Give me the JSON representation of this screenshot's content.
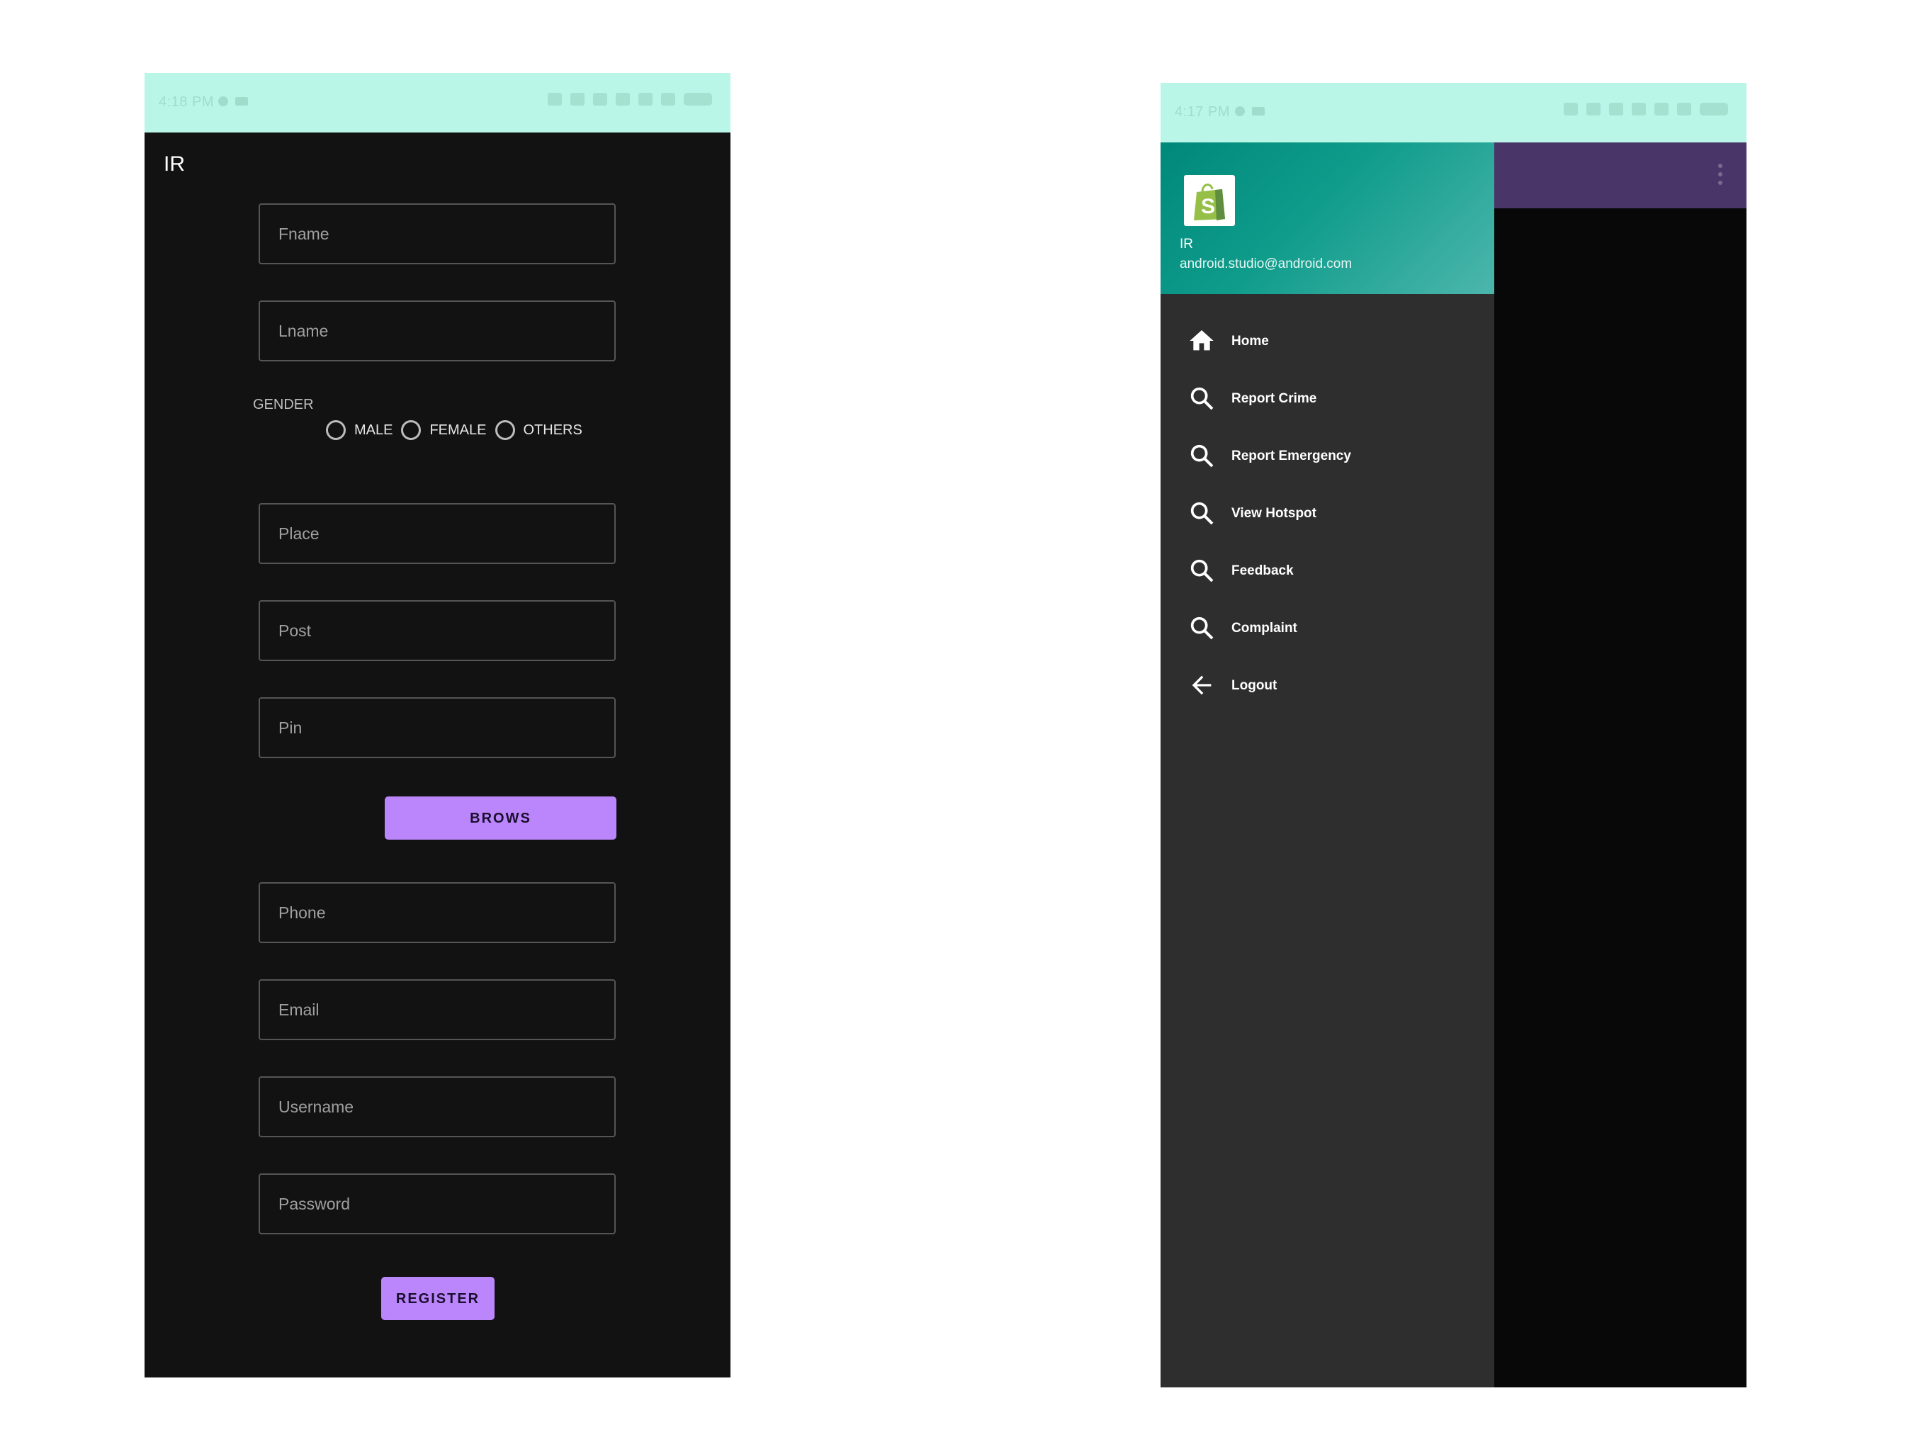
{
  "left_screen": {
    "status_time": "4:18 PM",
    "app_title": "IR",
    "fields": {
      "fname": "Fname",
      "lname": "Lname",
      "place": "Place",
      "post": "Post",
      "pin": "Pin",
      "phone": "Phone",
      "email": "Email",
      "username": "Username",
      "password": "Password"
    },
    "gender_label": "GENDER",
    "gender_options": [
      "MALE",
      "FEMALE",
      "OTHERS"
    ],
    "brows_label": "BROWS",
    "register_label": "REGISTER"
  },
  "right_screen": {
    "status_time": "4:17 PM",
    "drawer": {
      "name": "IR",
      "email": "android.studio@android.com",
      "items": [
        {
          "label": "Home",
          "icon": "home-icon"
        },
        {
          "label": "Report Crime",
          "icon": "search-icon"
        },
        {
          "label": "Report Emergency",
          "icon": "search-icon"
        },
        {
          "label": "View Hotspot",
          "icon": "search-icon"
        },
        {
          "label": "Feedback",
          "icon": "search-icon"
        },
        {
          "label": "Complaint",
          "icon": "search-icon"
        },
        {
          "label": "Logout",
          "icon": "arrow-back-icon"
        }
      ]
    },
    "app_bar": {
      "menu_icon": "more-vert-icon"
    }
  },
  "colors": {
    "status_bar": "#b9f6e7",
    "accent": "#bb86fc",
    "background": "#121212",
    "drawer_bg": "#2e2e2e",
    "header_teal": "#00897b",
    "app_bar": "#4a3568"
  }
}
